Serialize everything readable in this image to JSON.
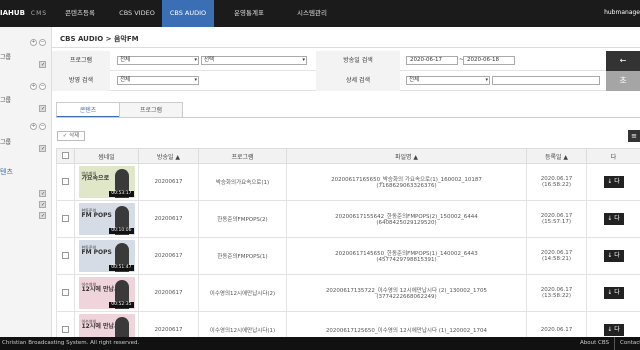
{
  "app": {
    "logo": "IAHUB",
    "logo_sub": "CMS",
    "user": "hubmanage"
  },
  "nav": [
    {
      "label": "콘텐츠등록",
      "active": false
    },
    {
      "label": "CBS VIDEO",
      "active": false
    },
    {
      "label": "CBS AUDIO",
      "active": true
    },
    {
      "label": "운영통계표",
      "active": false
    },
    {
      "label": "시스템관리",
      "active": false
    }
  ],
  "sidebar": {
    "label1": "그룹",
    "label2": "그룹",
    "label3": "그룹",
    "active_label": "텐츠"
  },
  "breadcrumb": "CBS AUDIO > 음악FM",
  "search": {
    "program_label": "프로그램",
    "program_select1": "전체",
    "program_select2": "선택",
    "date_label": "방송일 검색",
    "date_from": "2020-06-17",
    "date_sep": "~",
    "date_to": "2020-06-18",
    "type_label": "방영 검색",
    "type_select": "전체",
    "detail_label": "상세 검색",
    "detail_select": "전체",
    "detail_value": "",
    "search_btn": "←",
    "reset_btn": "초"
  },
  "tabs": [
    {
      "label": "콘텐츠",
      "active": true
    },
    {
      "label": "프로그램",
      "active": false
    }
  ],
  "actions": {
    "delete_label": "✓ 삭제",
    "grid_icon": "≡"
  },
  "table": {
    "headers": [
      "",
      "썸네일",
      "방송일 ▲",
      "프로그램",
      "파일명 ▲",
      "등록일 ▲",
      "다"
    ],
    "rows": [
      {
        "thumb_title": "박승화의",
        "thumb_sub": "가요속으로",
        "thumb_bg": "#dfe7c8",
        "duration": "00:53:17",
        "date": "20200617",
        "program": "박승화의가요속으로(1)",
        "file1": "20200617165650_박승화의 가요속으로(1)_160002_10187",
        "file2": "(7168629063326376)",
        "reg1": "2020.06.17",
        "reg2": "(16:58:22)",
        "dl": "↓ 다"
      },
      {
        "thumb_title": "한동준의",
        "thumb_sub": "FM POPS",
        "thumb_bg": "#d6dce6",
        "duration": "00:10:06",
        "date": "20200617",
        "program": "한동준의FMPOPS(2)",
        "file1": "20200617155642_한동준의FMPOPS(2)_150002_6444",
        "file2": "(6408425029129520)",
        "reg1": "2020.06.17",
        "reg2": "(15:57:17)",
        "dl": "↓ 다"
      },
      {
        "thumb_title": "한동준의",
        "thumb_sub": "FM POPS",
        "thumb_bg": "#d6dce6",
        "duration": "00:51:47",
        "date": "20200617",
        "program": "한동준의FMPOPS(1)",
        "file1": "20200617145650_한동준의FMPOPS(1)_140002_6443",
        "file2": "(4577429798815391)",
        "reg1": "2020.06.17",
        "reg2": "(14:58:21)",
        "dl": "↓ 다"
      },
      {
        "thumb_title": "이수영의",
        "thumb_sub": "12시에 만납시다",
        "thumb_bg": "#f0d4dc",
        "duration": "00:52:35",
        "date": "20200617",
        "program": "이수영의12시에만납시다(2)",
        "file1": "20200617135722_이수영의 12시에만납시다 (2)_130002_1705",
        "file2": "(3774222668062249)",
        "reg1": "2020.06.17",
        "reg2": "(13:58:22)",
        "dl": "↓ 다"
      },
      {
        "thumb_title": "이수영의",
        "thumb_sub": "12시에 만납시다",
        "thumb_bg": "#f0d4dc",
        "duration": "",
        "date": "20200617",
        "program": "이수영의12시에만납시다(1)",
        "file1": "20200617125650_이수영의 12시에만납시다 (1)_120002_1704",
        "file2": "",
        "reg1": "2020.06.17",
        "reg2": "",
        "dl": "↓ 다"
      }
    ]
  },
  "footer": {
    "copyright": "Christian Broadcasting System. All right reserved.",
    "about": "About CBS",
    "contact": "Contact"
  }
}
